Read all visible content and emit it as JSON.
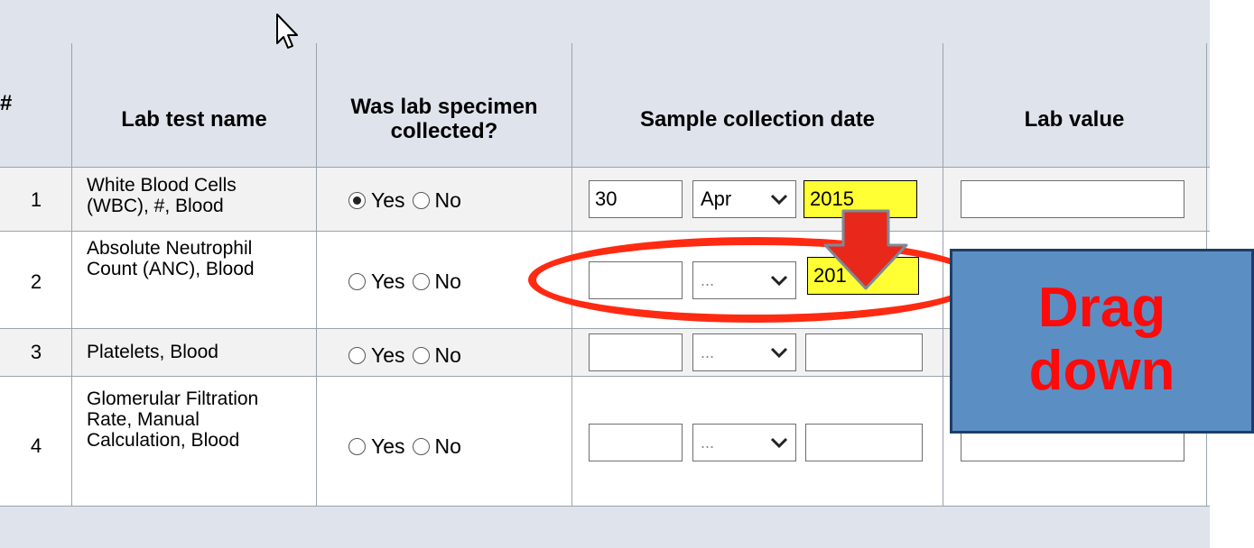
{
  "table": {
    "headers": {
      "num": "#",
      "test_name": "Lab test name",
      "collected": "Was lab specimen collected?",
      "date": "Sample collection date",
      "value": "Lab value"
    },
    "radio_labels": {
      "yes": "Yes",
      "no": "No"
    },
    "rows": [
      {
        "num": "1",
        "name": "White Blood Cells (WBC), #, Blood",
        "collected": "Yes",
        "day": "30",
        "month": "Apr",
        "year": "2015",
        "lab_value": ""
      },
      {
        "num": "2",
        "name": "Absolute Neutrophil Count (ANC), Blood",
        "collected": "",
        "day": "",
        "month": "...",
        "year": "201",
        "lab_value": ""
      },
      {
        "num": "3",
        "name": "Platelets, Blood",
        "collected": "",
        "day": "",
        "month": "...",
        "year": "",
        "lab_value": ""
      },
      {
        "num": "4",
        "name": "Glomerular Filtration Rate, Manual Calculation, Blood",
        "collected": "",
        "day": "",
        "month": "...",
        "year": "",
        "lab_value": ""
      }
    ]
  },
  "annotation": {
    "callout_line1": "Drag",
    "callout_line2": "down",
    "highlight_color": "#ffff33",
    "arrow_color": "#e8281a",
    "oval_color": "#ff2a12"
  }
}
